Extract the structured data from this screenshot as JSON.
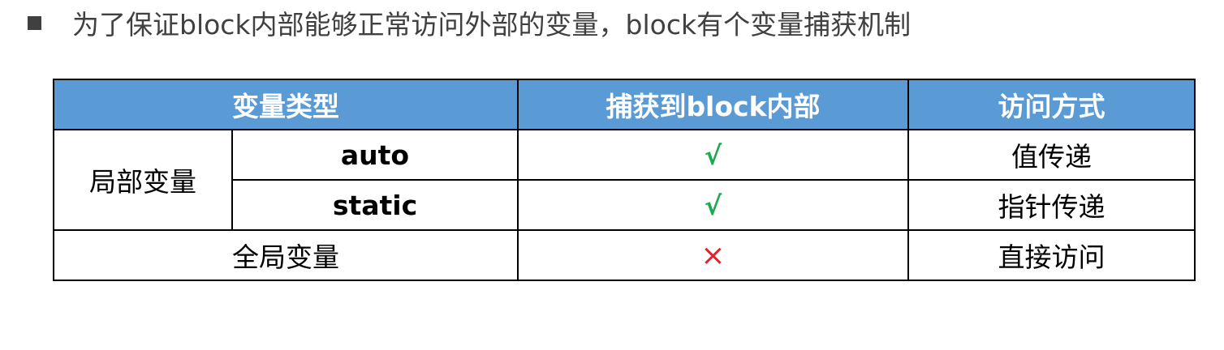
{
  "intro": {
    "text": "为了保证block内部能够正常访问外部的变量，block有个变量捕获机制",
    "bullet_color": "#404040"
  },
  "table": {
    "header_color": "#5b9bd5",
    "headers": {
      "var_type": "变量类型",
      "captured": "捕获到block内部",
      "access": "访问方式"
    },
    "local_group_label": "局部变量",
    "rows": [
      {
        "subtype": "auto",
        "captured": "√",
        "access": "值传递"
      },
      {
        "subtype": "static",
        "captured": "√",
        "access": "指针传递"
      }
    ],
    "global_row": {
      "label": "全局变量",
      "captured": "×",
      "access": "直接访问"
    },
    "colors": {
      "check": "#1ea84f",
      "cross": "#e8202a"
    }
  }
}
